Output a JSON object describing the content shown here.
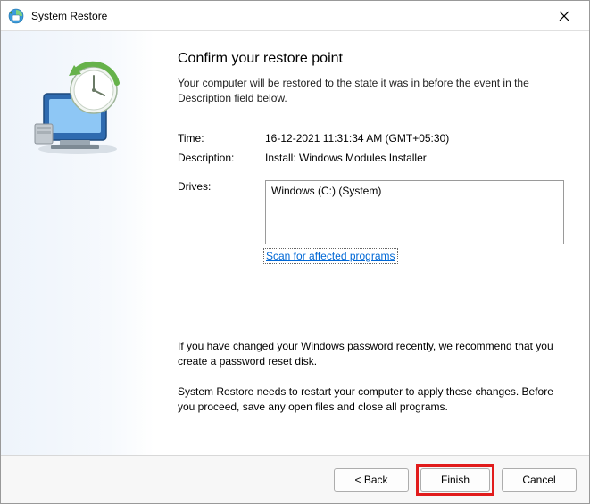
{
  "window": {
    "title": "System Restore"
  },
  "main": {
    "heading": "Confirm your restore point",
    "intro": "Your computer will be restored to the state it was in before the event in the Description field below.",
    "time_label": "Time:",
    "time_value": "16-12-2021 11:31:34 AM (GMT+05:30)",
    "description_label": "Description:",
    "description_value": "Install: Windows Modules Installer",
    "drives_label": "Drives:",
    "drives_value": "Windows (C:) (System)",
    "scan_link": "Scan for affected programs",
    "note_password": "If you have changed your Windows password recently, we recommend that you create a password reset disk.",
    "note_restart": "System Restore needs to restart your computer to apply these changes. Before you proceed, save any open files and close all programs."
  },
  "footer": {
    "back": "< Back",
    "finish": "Finish",
    "cancel": "Cancel"
  }
}
